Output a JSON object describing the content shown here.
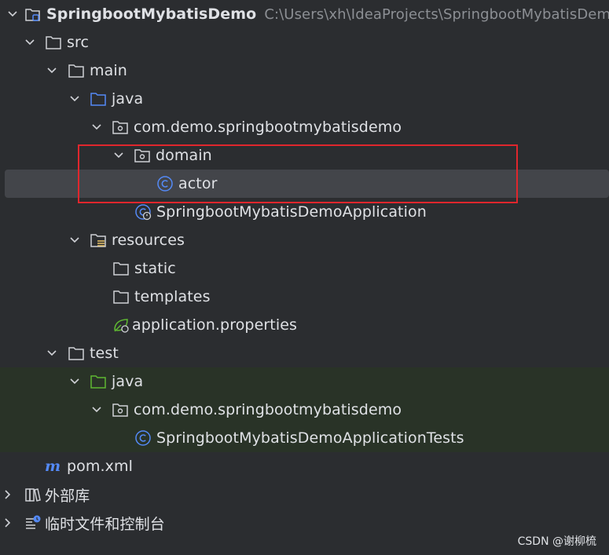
{
  "project": {
    "name": "SpringbootMybatisDemo",
    "path": "C:\\Users\\xh\\IdeaProjects\\SpringbootMybatisDemo"
  },
  "tree": {
    "src": "src",
    "main": "main",
    "java_main": "java",
    "package_main": "com.demo.springbootmybatisdemo",
    "domain": "domain",
    "actor": "actor",
    "app_class": "SpringbootMybatisDemoApplication",
    "resources": "resources",
    "static": "static",
    "templates": "templates",
    "app_properties": "application.properties",
    "test": "test",
    "java_test": "java",
    "package_test": "com.demo.springbootmybatisdemo",
    "test_class": "SpringbootMybatisDemoApplicationTests",
    "pom": "pom.xml",
    "external_libs": "外部库",
    "scratches": "临时文件和控制台"
  },
  "icons": {
    "module": "module-folder-icon",
    "folder": "folder-icon",
    "source_root": "source-root-folder-icon",
    "package": "package-icon",
    "class": "class-icon",
    "spring_class": "spring-boot-class-icon",
    "resources_root": "resources-root-icon",
    "spring_properties": "spring-properties-icon",
    "test_root": "test-root-folder-icon",
    "maven": "maven-icon",
    "library": "library-icon",
    "scratches": "scratches-icon"
  },
  "colors": {
    "background": "#2b2d30",
    "selection": "#43454a",
    "test_highlight": "#293327",
    "annotation_box": "#e0262d",
    "class_blue": "#548af7",
    "spring_green": "#5fb832"
  },
  "watermark": "CSDN @谢柳梳"
}
